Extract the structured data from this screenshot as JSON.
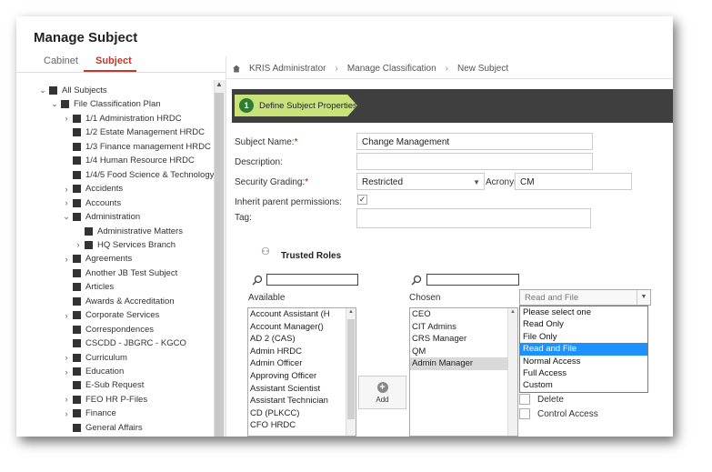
{
  "header": {
    "title": "Manage Subject"
  },
  "tabs": [
    {
      "label": "Cabinet"
    },
    {
      "label": "Subject"
    }
  ],
  "tree": [
    {
      "label": "All Subjects",
      "chev": "⌄"
    },
    {
      "label": "File Classification Plan",
      "chev": "⌄"
    },
    {
      "label": "1/1 Administration HRDC",
      "chev": "›"
    },
    {
      "label": "1/2 Estate Management HRDC",
      "chev": ""
    },
    {
      "label": "1/3 Finance management HRDC",
      "chev": ""
    },
    {
      "label": "1/4 Human Resource HRDC",
      "chev": ""
    },
    {
      "label": "1/4/5 Food Science & Technology",
      "chev": ""
    },
    {
      "label": "Accidents",
      "chev": "›"
    },
    {
      "label": "Accounts",
      "chev": "›"
    },
    {
      "label": "Administration",
      "chev": "⌄"
    },
    {
      "label": "Administrative Matters",
      "chev": ""
    },
    {
      "label": "HQ Services Branch",
      "chev": "›"
    },
    {
      "label": "Agreements",
      "chev": "›"
    },
    {
      "label": "Another JB Test Subject",
      "chev": ""
    },
    {
      "label": "Articles",
      "chev": ""
    },
    {
      "label": "Awards & Accreditation",
      "chev": ""
    },
    {
      "label": "Corporate Services",
      "chev": "›"
    },
    {
      "label": "Correspondences",
      "chev": ""
    },
    {
      "label": "CSCDD - JBGRC - KGCO",
      "chev": ""
    },
    {
      "label": "Curriculum",
      "chev": "›"
    },
    {
      "label": "Education",
      "chev": "›"
    },
    {
      "label": "E-Sub Request",
      "chev": ""
    },
    {
      "label": "FEO HR P-Files",
      "chev": "›"
    },
    {
      "label": "Finance",
      "chev": "›"
    },
    {
      "label": "General Affairs",
      "chev": ""
    }
  ],
  "breadcrumb": {
    "items": [
      "KRIS Administrator",
      "Manage Classification",
      "New Subject"
    ],
    "sep": "›"
  },
  "wizard": {
    "step_number": "1",
    "step_label": "Define Subject Properties"
  },
  "form": {
    "subject_name_label": "Subject Name:",
    "subject_name_value": "Change Management",
    "description_label": "Description:",
    "security_grading_label": "Security Grading:",
    "security_grading_value": "Restricted",
    "acronym_label": "Acronym",
    "acronym_value": "CM",
    "inherit_label": "Inherit parent permissions:",
    "inherit_checked": "✓",
    "tag_label": "Tag:",
    "required_mark": "*"
  },
  "trusted_roles": {
    "title": "Trusted Roles",
    "available_label": "Available",
    "chosen_label": "Chosen",
    "available": [
      "Account Assistant (H",
      "Account Manager()",
      "AD 2 (CAS)",
      "Admin HRDC",
      "Admin Officer",
      "Approving Officer",
      "Assistant Scientist",
      "Assistant Technician",
      "CD (PLKCC)",
      "CFO HRDC"
    ],
    "chosen": [
      "CEO",
      "CIT Admins",
      "CRS Manager",
      "QM",
      "Admin Manager"
    ],
    "chosen_selected_index": 4,
    "add_label": "Add"
  },
  "access": {
    "selected": "Read and File",
    "options": [
      "Please select one",
      "Read Only",
      "File Only",
      "Read and File",
      "Normal Access",
      "Full Access",
      "Custom"
    ],
    "highlight_index": 3
  },
  "permissions": [
    "Delete",
    "Control Access"
  ],
  "icons": {
    "home": "home-icon",
    "search": "search-icon",
    "users": "users-icon",
    "add": "plus-icon"
  },
  "colors": {
    "accent": "#c0392b",
    "step": "#c9e37a",
    "dropdown_highlight": "#1e90ff",
    "wizard_bar": "#3f3f3f"
  }
}
